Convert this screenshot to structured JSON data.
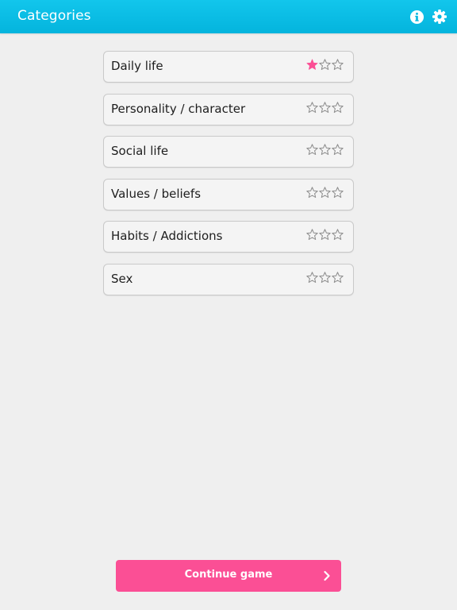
{
  "header": {
    "title": "Categories",
    "icons": [
      "info-icon",
      "gear-icon"
    ]
  },
  "categories": [
    {
      "label": "Daily life",
      "stars_filled": 1,
      "stars_total": 3
    },
    {
      "label": "Personality / character",
      "stars_filled": 0,
      "stars_total": 3
    },
    {
      "label": "Social life",
      "stars_filled": 0,
      "stars_total": 3
    },
    {
      "label": "Values / beliefs",
      "stars_filled": 0,
      "stars_total": 3
    },
    {
      "label": "Habits / Addictions",
      "stars_filled": 0,
      "stars_total": 3
    },
    {
      "label": "Sex",
      "stars_filled": 0,
      "stars_total": 3
    }
  ],
  "continue_button": {
    "label": "Continue game",
    "icon": "chevron-right-icon"
  },
  "colors": {
    "header": "#04b4dd",
    "accent": "#fb4f95",
    "star_empty": "#8a8a8a",
    "star_filled": "#fb4f95",
    "background": "#efefef"
  }
}
